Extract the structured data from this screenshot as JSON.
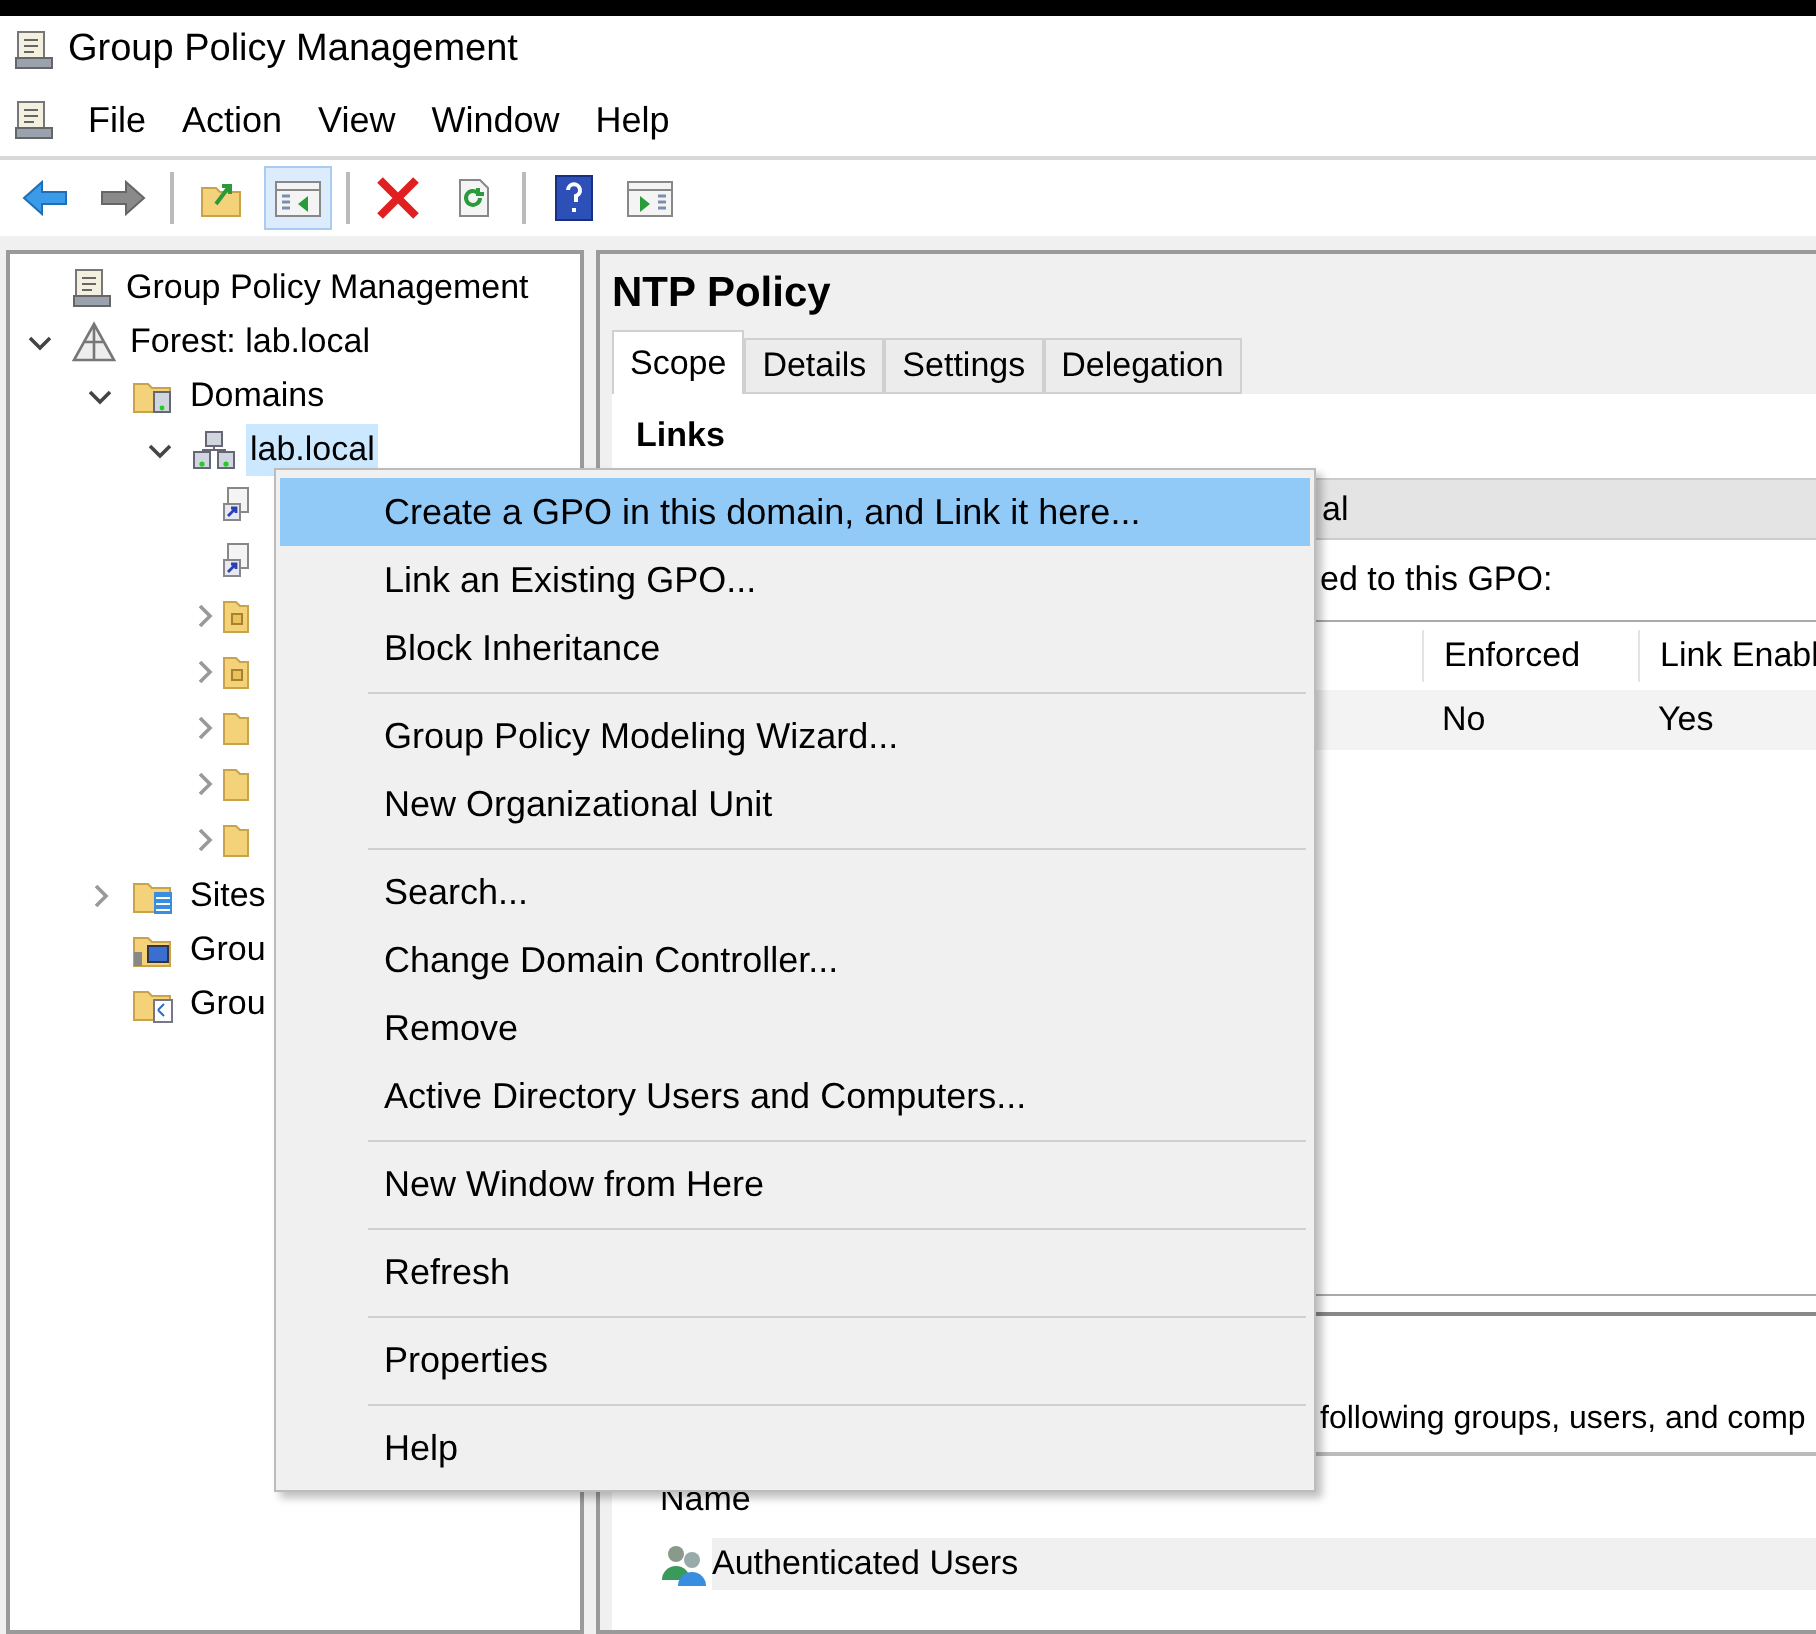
{
  "window": {
    "title": "Group Policy Management"
  },
  "menu_bar": [
    "File",
    "Action",
    "View",
    "Window",
    "Help"
  ],
  "toolbar": [
    {
      "kind": "back",
      "selected": false
    },
    {
      "kind": "forward",
      "selected": false
    },
    {
      "kind": "separator"
    },
    {
      "kind": "up",
      "selected": false
    },
    {
      "kind": "pane",
      "selected": true
    },
    {
      "kind": "separator"
    },
    {
      "kind": "delete",
      "selected": false
    },
    {
      "kind": "refresh",
      "selected": false
    },
    {
      "kind": "separator"
    },
    {
      "kind": "help",
      "selected": false
    },
    {
      "kind": "action-pane",
      "selected": false
    }
  ],
  "tree": [
    {
      "kind": "console",
      "label": "Group Policy Management",
      "selected": false,
      "children": [
        {
          "kind": "forest",
          "label": "Forest: lab.local",
          "expanded": true,
          "selected": false,
          "children": [
            {
              "kind": "domains",
              "label": "Domains",
              "expanded": true,
              "selected": false,
              "children": [
                {
                  "kind": "domain",
                  "label": "lab.local",
                  "expanded": true,
                  "selected": true,
                  "children": [
                    {
                      "kind": "gpo-link",
                      "selected": false
                    },
                    {
                      "kind": "gpo-link",
                      "selected": false
                    },
                    {
                      "kind": "ou",
                      "expanded": false,
                      "selected": false
                    },
                    {
                      "kind": "ou",
                      "expanded": false,
                      "selected": false
                    },
                    {
                      "kind": "folder",
                      "expanded": false,
                      "selected": false
                    },
                    {
                      "kind": "folder",
                      "expanded": false,
                      "selected": false
                    },
                    {
                      "kind": "folder",
                      "expanded": false,
                      "selected": false
                    }
                  ]
                }
              ]
            },
            {
              "kind": "sites",
              "label": "Sites",
              "expanded": false,
              "selected": false
            },
            {
              "kind": "modeling",
              "label": "Grou",
              "selected": false
            },
            {
              "kind": "results",
              "label": "Grou",
              "selected": false
            }
          ]
        }
      ]
    }
  ],
  "details": {
    "title": "NTP Policy",
    "tabs": [
      {
        "label": "Scope",
        "selected": true
      },
      {
        "label": "Details",
        "selected": false
      },
      {
        "label": "Settings",
        "selected": false
      },
      {
        "label": "Delegation",
        "selected": false
      }
    ],
    "links_heading": "Links",
    "location_fragment": "al",
    "links_caption_fragment": "ed to this GPO:",
    "links_table": {
      "columns": [
        "Enforced",
        "Link Enabl"
      ],
      "rows": [
        [
          "No",
          "Yes"
        ]
      ]
    },
    "filtering_caption_fragment": "following groups, users, and comp",
    "filtering_table": {
      "columns": [
        "Name"
      ],
      "rows": [
        [
          "Authenticated Users"
        ]
      ]
    }
  },
  "context_menu": [
    {
      "kind": "item",
      "label": "Create a GPO in this domain, and Link it here...",
      "selected": true
    },
    {
      "kind": "item",
      "label": "Link an Existing GPO...",
      "selected": false
    },
    {
      "kind": "item",
      "label": "Block Inheritance",
      "selected": false
    },
    {
      "kind": "separator"
    },
    {
      "kind": "item",
      "label": "Group Policy Modeling Wizard...",
      "selected": false
    },
    {
      "kind": "item",
      "label": "New Organizational Unit",
      "selected": false
    },
    {
      "kind": "separator"
    },
    {
      "kind": "item",
      "label": "Search...",
      "selected": false
    },
    {
      "kind": "item",
      "label": "Change Domain Controller...",
      "selected": false
    },
    {
      "kind": "item",
      "label": "Remove",
      "selected": false
    },
    {
      "kind": "item",
      "label": "Active Directory Users and Computers...",
      "selected": false
    },
    {
      "kind": "separator"
    },
    {
      "kind": "item",
      "label": "New Window from Here",
      "selected": false
    },
    {
      "kind": "separator"
    },
    {
      "kind": "item",
      "label": "Refresh",
      "selected": false
    },
    {
      "kind": "separator"
    },
    {
      "kind": "item",
      "label": "Properties",
      "selected": false
    },
    {
      "kind": "separator"
    },
    {
      "kind": "item",
      "label": "Help",
      "selected": false
    }
  ]
}
